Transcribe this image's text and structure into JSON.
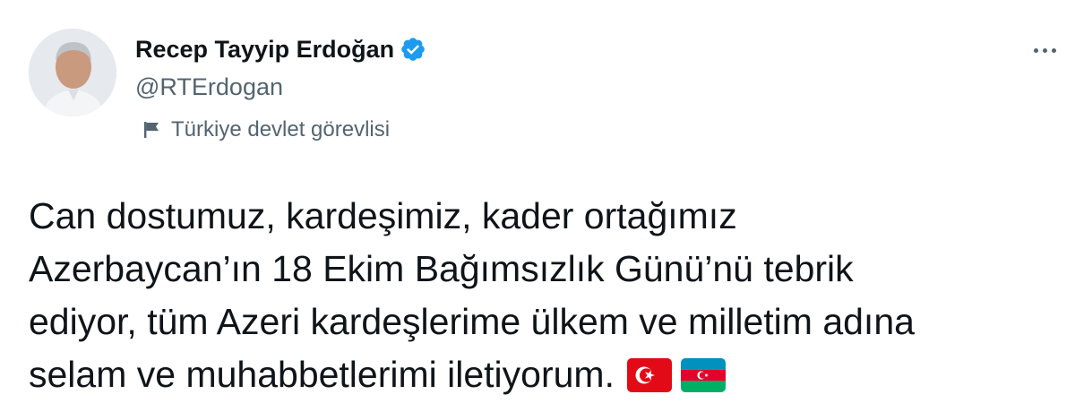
{
  "author": {
    "display_name": "Recep Tayyip Erdoğan",
    "handle": "@RTErdogan",
    "verified": true,
    "affiliation_label": "Türkiye devlet görevlisi"
  },
  "tweet": {
    "text_lines": [
      "Can dostumuz, kardeşimiz, kader ortağımız",
      "Azerbaycan’ın 18 Ekim Bağımsızlık Günü’nü tebrik",
      "ediyor, tüm Azeri kardeşlerime ülkem ve milletim adına",
      "selam ve muhabbetlerimi iletiyorum."
    ],
    "emojis": [
      "turkey-flag",
      "azerbaijan-flag"
    ]
  },
  "icons": {
    "verified": "verified-badge-icon",
    "affiliation": "government-flag-icon",
    "more": "more-options-icon"
  },
  "colors": {
    "verified_blue": "#1d9bf0",
    "secondary_text": "#536471",
    "primary_text": "#0f1419"
  }
}
